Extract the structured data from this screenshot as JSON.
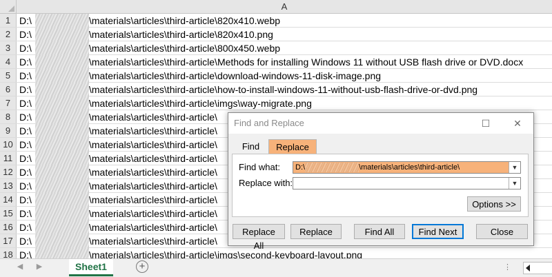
{
  "sheet": {
    "column_header": "A",
    "rows": [
      {
        "num": "1",
        "drive": "D:\\",
        "path": "\\materials\\articles\\third-article\\820x410.webp"
      },
      {
        "num": "2",
        "drive": "D:\\",
        "path": "\\materials\\articles\\third-article\\820x410.png"
      },
      {
        "num": "3",
        "drive": "D:\\",
        "path": "\\materials\\articles\\third-article\\800x450.webp"
      },
      {
        "num": "4",
        "drive": "D:\\",
        "path": "\\materials\\articles\\third-article\\Methods for installing Windows 11 without USB flash drive or DVD.docx"
      },
      {
        "num": "5",
        "drive": "D:\\",
        "path": "\\materials\\articles\\third-article\\download-windows-11-disk-image.png"
      },
      {
        "num": "6",
        "drive": "D:\\",
        "path": "\\materials\\articles\\third-article\\how-to-install-windows-11-without-usb-flash-drive-or-dvd.png"
      },
      {
        "num": "7",
        "drive": "D:\\",
        "path": "\\materials\\articles\\third-article\\imgs\\way-migrate.png"
      },
      {
        "num": "8",
        "drive": "D:\\",
        "path": "\\materials\\articles\\third-article\\"
      },
      {
        "num": "9",
        "drive": "D:\\",
        "path": "\\materials\\articles\\third-article\\"
      },
      {
        "num": "10",
        "drive": "D:\\",
        "path": "\\materials\\articles\\third-article\\"
      },
      {
        "num": "11",
        "drive": "D:\\",
        "path": "\\materials\\articles\\third-article\\"
      },
      {
        "num": "12",
        "drive": "D:\\",
        "path": "\\materials\\articles\\third-article\\"
      },
      {
        "num": "13",
        "drive": "D:\\",
        "path": "\\materials\\articles\\third-article\\"
      },
      {
        "num": "14",
        "drive": "D:\\",
        "path": "\\materials\\articles\\third-article\\"
      },
      {
        "num": "15",
        "drive": "D:\\",
        "path": "\\materials\\articles\\third-article\\"
      },
      {
        "num": "16",
        "drive": "D:\\",
        "path": "\\materials\\articles\\third-article\\"
      },
      {
        "num": "17",
        "drive": "D:\\",
        "path": "\\materials\\articles\\third-article\\"
      },
      {
        "num": "18",
        "drive": "D:\\",
        "path": "\\materials\\articles\\third-article\\imgs\\second-keyboard-layout.png"
      }
    ]
  },
  "tabbar": {
    "sheet_tab": "Sheet1",
    "add_sheet": "+",
    "prev_arrow": "◀",
    "next_arrow": "▶",
    "separator": "⋮"
  },
  "dialog": {
    "title": "Find and Replace",
    "minimize_glyph": "",
    "maximize_glyph": "☐",
    "close_glyph": "✕",
    "tabs": {
      "find": "Find",
      "replace": "Replace"
    },
    "find_what_label": "Find what:",
    "find_what_prefix": "D:\\",
    "find_what_suffix": "\\materials\\articles\\third-article\\",
    "replace_with_label": "Replace with:",
    "replace_with_value": "",
    "options_button": "Options >>",
    "buttons": {
      "replace_all": "Replace All",
      "replace": "Replace",
      "find_all": "Find All",
      "find_next": "Find Next",
      "close": "Close"
    },
    "highlight_color": "#f7b27a"
  },
  "colors": {
    "excel_green": "#217346",
    "focus_blue": "#0078d7"
  }
}
